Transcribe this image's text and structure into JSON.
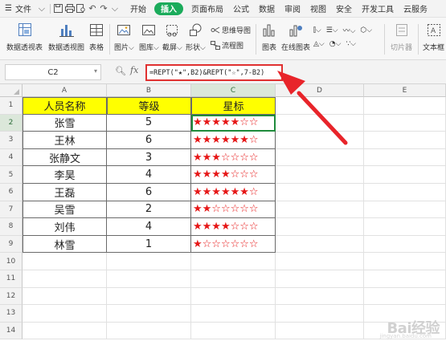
{
  "menubar": {
    "file_label": "文件",
    "tabs": [
      "开始",
      "插入",
      "页面布局",
      "公式",
      "数据",
      "审阅",
      "视图",
      "安全",
      "开发工具",
      "云服务"
    ],
    "active_tab": "插入"
  },
  "ribbon": {
    "pivot_table": "数据透视表",
    "pivot_chart": "数据透视图",
    "table": "表格",
    "picture": "图片",
    "gallery": "图库",
    "screenshot": "截屏",
    "shapes": "形状",
    "mindmap": "思维导图",
    "flowchart": "流程图",
    "chart": "图表",
    "online_chart": "在线图表",
    "clipart": "切片器",
    "textbox": "文本框"
  },
  "formula_bar": {
    "cell_ref": "C2",
    "fx_label": "fx",
    "formula": "=REPT(\"★\",B2)&REPT(\"☆\",7-B2)"
  },
  "columns": [
    "A",
    "B",
    "C",
    "D",
    "E"
  ],
  "rows": [
    "1",
    "2",
    "3",
    "4",
    "5",
    "6",
    "7",
    "8",
    "9",
    "10",
    "11",
    "12",
    "13",
    "14"
  ],
  "table": {
    "headers": [
      "人员名称",
      "等级",
      "星标"
    ],
    "data": [
      {
        "name": "张雪",
        "level": "5",
        "stars": "★★★★★☆☆"
      },
      {
        "name": "王林",
        "level": "6",
        "stars": "★★★★★★☆"
      },
      {
        "name": "张静文",
        "level": "3",
        "stars": "★★★☆☆☆☆"
      },
      {
        "name": "李昊",
        "level": "4",
        "stars": "★★★★☆☆☆"
      },
      {
        "name": "王磊",
        "level": "6",
        "stars": "★★★★★★☆"
      },
      {
        "name": "吴雪",
        "level": "2",
        "stars": "★★☆☆☆☆☆"
      },
      {
        "name": "刘伟",
        "level": "4",
        "stars": "★★★★☆☆☆"
      },
      {
        "name": "林雪",
        "level": "1",
        "stars": "★☆☆☆☆☆☆"
      }
    ]
  },
  "watermark": {
    "logo": "Bai经验",
    "sub": "jingyan.baidu.com"
  },
  "colors": {
    "header_fill": "#ffff00",
    "star_color": "#e61717",
    "active_tab": "#1bab5b",
    "selection": "#1f8b3c",
    "arrow": "#e8242a"
  }
}
